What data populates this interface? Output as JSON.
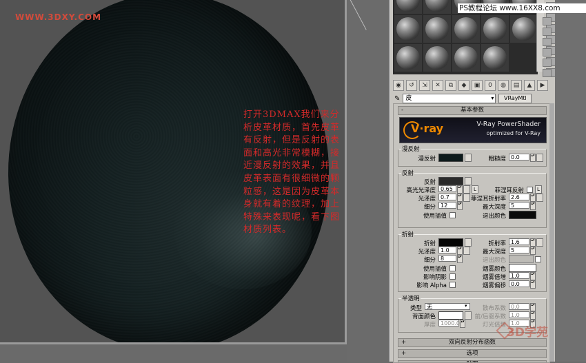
{
  "viewport": {
    "watermark": "WWW.3DXY.COM",
    "annotation": "打开3DMAX我们来分析皮革材质，首先皮革有反射，但是反射的表面和高光非常模糊，接近漫反射的效果，并且皮革表面有很细微的颗粒感，这是因为皮革本身就有着的纹理，加上特殊来表现呢，看下图材质列表。"
  },
  "top_watermark": "PS教程论坛 www.16XX8.com",
  "material_editor": {
    "material_name": "皮",
    "material_type": "VRayMtl",
    "basic_params_label": "基本参数",
    "banner": {
      "logo": "V·ray",
      "title": "V-Ray PowerShader",
      "subtitle": "optimized for V-Ray"
    },
    "diffuse": {
      "group": "漫反射",
      "diffuse_label": "漫反射",
      "diffuse_color": "#0d1a1c",
      "roughness_label": "粗糙度",
      "roughness": "0.0"
    },
    "reflection": {
      "group": "反射",
      "reflect_label": "反射",
      "reflect_color": "#2a2a2a",
      "hilight_gloss_label": "高光光泽度",
      "hilight_gloss": "0.65",
      "l_label": "L",
      "fresnel_label": "菲涅耳反射",
      "refl_gloss_label": "光泽度",
      "refl_gloss": "0.7",
      "fresnel_ior_label": "菲涅耳折射率",
      "fresnel_ior": "2.6",
      "subdivs_label": "细分",
      "subdivs": "12",
      "max_depth_label": "最大深度",
      "max_depth": "5",
      "use_interp_label": "使用插值",
      "exit_color_label": "退出颜色",
      "exit_color": "#0b0b0b"
    },
    "refraction": {
      "group": "折射",
      "refract_label": "折射",
      "refract_color": "#050505",
      "ior_label": "折射率",
      "ior": "1.6",
      "gloss_label": "光泽度",
      "gloss": "1.0",
      "max_depth_label": "最大深度",
      "max_depth": "5",
      "subdivs_label": "细分",
      "subdivs": "8",
      "exit_color_label": "退出颜色",
      "use_interp_label": "使用插值",
      "fog_color_label": "烟雾颜色",
      "affect_shadows_label": "影响阴影",
      "fog_mult_label": "烟雾倍增",
      "fog_mult": "1.0",
      "affect_alpha_label": "影响 Alpha",
      "fog_bias_label": "烟雾偏移",
      "fog_bias": "0.0"
    },
    "translucency": {
      "group": "半透明",
      "type_label": "类型",
      "type_value": "无",
      "scatter_label": "散布系数",
      "scatter": "0.0",
      "back_color_label": "背面颜色",
      "fwd_back_label": "前/后驱系数",
      "fwd_back": "1.0",
      "thickness_label": "厚度",
      "thickness": "1000.0",
      "light_mult_label": "灯光倍增",
      "light_mult": "1.0"
    },
    "rollouts": [
      {
        "pm": "+",
        "label": "双向反射分布函数"
      },
      {
        "pm": "+",
        "label": "选项"
      },
      {
        "pm": "-",
        "label": "贴图"
      }
    ]
  },
  "logo_bottom": "3D学苑"
}
